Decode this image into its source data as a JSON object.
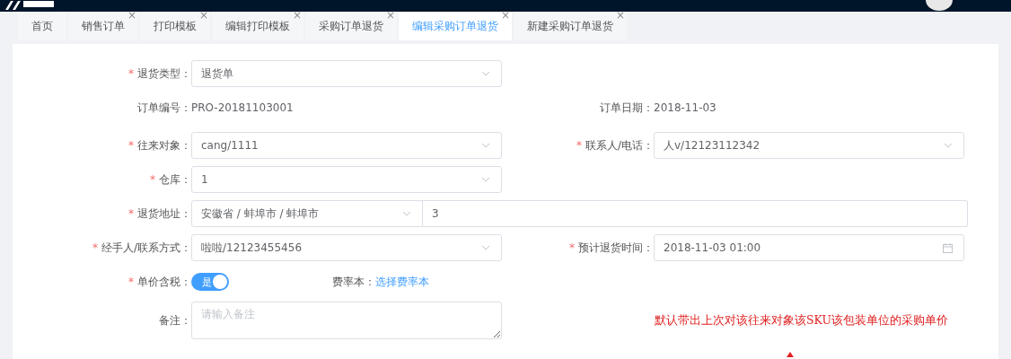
{
  "tabs": [
    {
      "label": "首页",
      "selected": false
    },
    {
      "label": "销售订单",
      "close": "×",
      "selected": false
    },
    {
      "label": "打印模板",
      "close": "×",
      "selected": false
    },
    {
      "label": "编辑打印模板",
      "close": "×",
      "selected": false
    },
    {
      "label": "采购订单退货",
      "close": "×",
      "selected": false
    },
    {
      "label": "编辑采购订单退货",
      "close": "×",
      "selected": true
    },
    {
      "label": "新建采购订单退货",
      "close": "×",
      "selected": false
    }
  ],
  "form": {
    "rows": [
      {
        "left": {
          "kind": "select",
          "mark": "*",
          "label": "退货类型：",
          "value": "退货单"
        }
      },
      {
        "left": {
          "kind": "text",
          "label": "订单编号：",
          "value": "PRO-20181103001"
        },
        "right": {
          "kind": "text",
          "label": "订单日期：",
          "value": "2018-11-03"
        }
      },
      {
        "left": {
          "kind": "select",
          "mark": "*",
          "label": "往来对象：",
          "value": "cang/1111"
        },
        "right": {
          "kind": "select",
          "mark": "*",
          "label": "联系人/电话：",
          "value": "人v/12123112342"
        }
      },
      {
        "left": {
          "kind": "select",
          "mark": "*",
          "label": "仓库：",
          "value": "1"
        }
      },
      {
        "left": {
          "kind": "address",
          "mark": "*",
          "label": "退货地址：",
          "value": "安徽省 / 蚌埠市 / 蚌埠市",
          "detail": "3"
        }
      },
      {
        "left": {
          "kind": "select",
          "mark": "*",
          "label": "经手人/联系方式：",
          "value": "啦啦/12123455456"
        },
        "right": {
          "kind": "datetime",
          "mark": "*",
          "label": "预计退货时间：",
          "value": "2018-11-03 01:00"
        }
      },
      {
        "left": {
          "kind": "switch",
          "mark": "*",
          "label": "单价含税：",
          "value": "是",
          "on": true
        },
        "right": {
          "kind": "link",
          "label": "费率本：",
          "value": "选择费率本"
        }
      },
      {
        "left": {
          "kind": "textarea",
          "label": "备注：",
          "placeholder": "请输入备注"
        },
        "right": {
          "kind": "note",
          "value": "默认带出上次对该往来对象该SKU该包装单位的采购单价"
        }
      }
    ]
  }
}
